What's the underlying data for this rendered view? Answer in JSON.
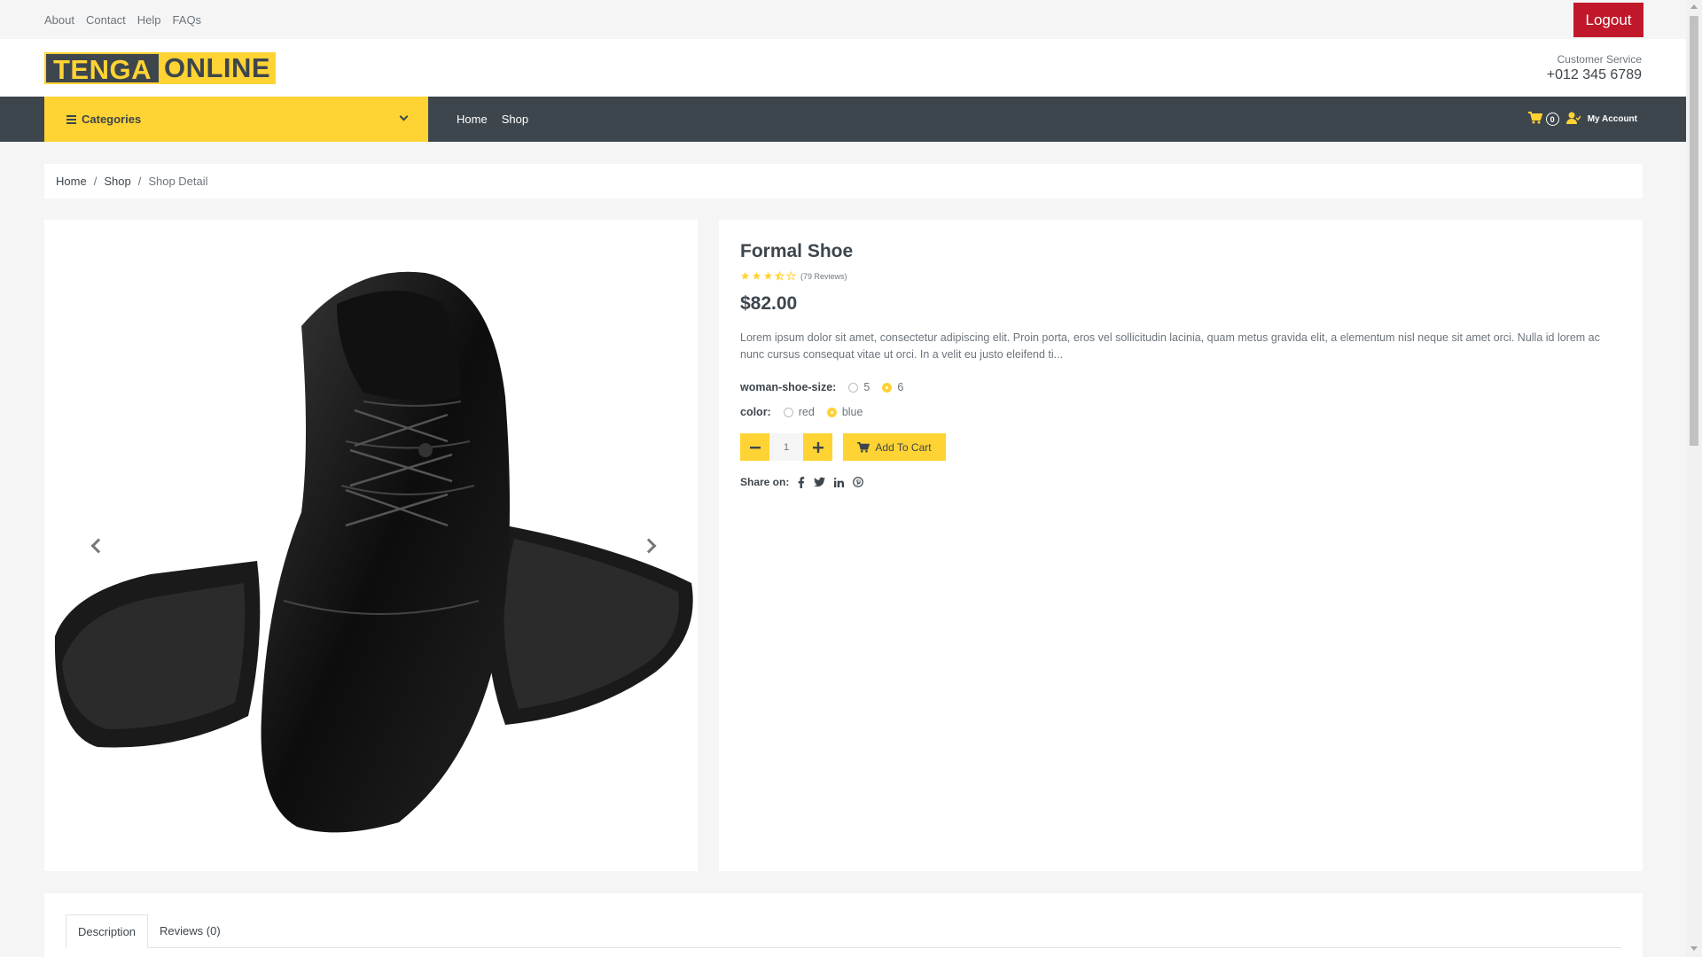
{
  "topbar": {
    "links": [
      "About",
      "Contact",
      "Help",
      "FAQs"
    ],
    "logout_label": "Logout"
  },
  "header": {
    "logo_part1": "TENGA",
    "logo_part2": "ONLINE",
    "customer_service_label": "Customer Service",
    "phone": "+012 345 6789"
  },
  "nav": {
    "categories_label": "Categories",
    "links": [
      "Home",
      "Shop"
    ],
    "cart_count": "0",
    "account_label": "My Account"
  },
  "breadcrumb": {
    "items": [
      "Home",
      "Shop"
    ],
    "current": "Shop Detail"
  },
  "product": {
    "title": "Formal Shoe",
    "rating": 3.5,
    "rating_max": 5,
    "reviews_text": "(79 Reviews)",
    "price": "$82.00",
    "description": "Lorem ipsum dolor sit amet, consectetur adipiscing elit. Proin porta, eros vel sollicitudin lacinia, quam metus gravida elit, a elementum nisl neque sit amet orci. Nulla id lorem ac nunc cursus consequat vitae ut orci. In a velit eu justo eleifend ti...",
    "size_label": "woman-shoe-size:",
    "sizes": [
      "5",
      "6"
    ],
    "selected_size": "6",
    "color_label": "color:",
    "colors": [
      "red",
      "blue"
    ],
    "selected_color": "blue",
    "quantity": "1",
    "add_to_cart_label": "Add To Cart",
    "share_label": "Share on:",
    "share_icons": [
      "facebook-icon",
      "twitter-icon",
      "linkedin-icon",
      "pinterest-icon"
    ]
  },
  "tabs": {
    "items": [
      "Description",
      "Reviews (0)"
    ],
    "active": "Description"
  },
  "colors": {
    "accent": "#FFD333",
    "dark": "#3D464D",
    "logout": "#C0182A"
  }
}
